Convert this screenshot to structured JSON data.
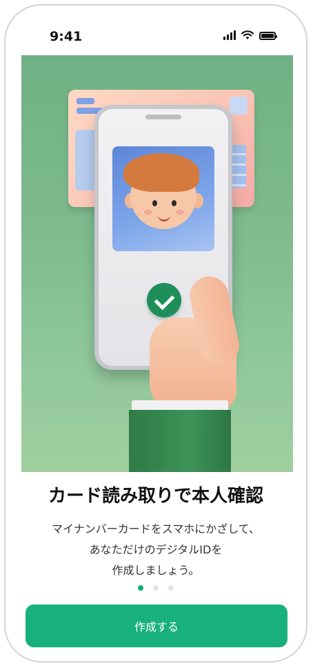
{
  "status_bar": {
    "time": "9:41"
  },
  "onboarding": {
    "title": "カード読み取りで本人確認",
    "description_lines": [
      "マイナンバーカードをスマホにかざして、",
      "あなただけのデジタルIDを",
      "作成しましょう。"
    ],
    "page_indicator": {
      "current": 1,
      "total": 3
    }
  },
  "cta": {
    "label": "作成する"
  },
  "colors": {
    "accent": "#18b07c",
    "hero_background": "#7fbc8f",
    "check_badge": "#1e8f5a"
  }
}
